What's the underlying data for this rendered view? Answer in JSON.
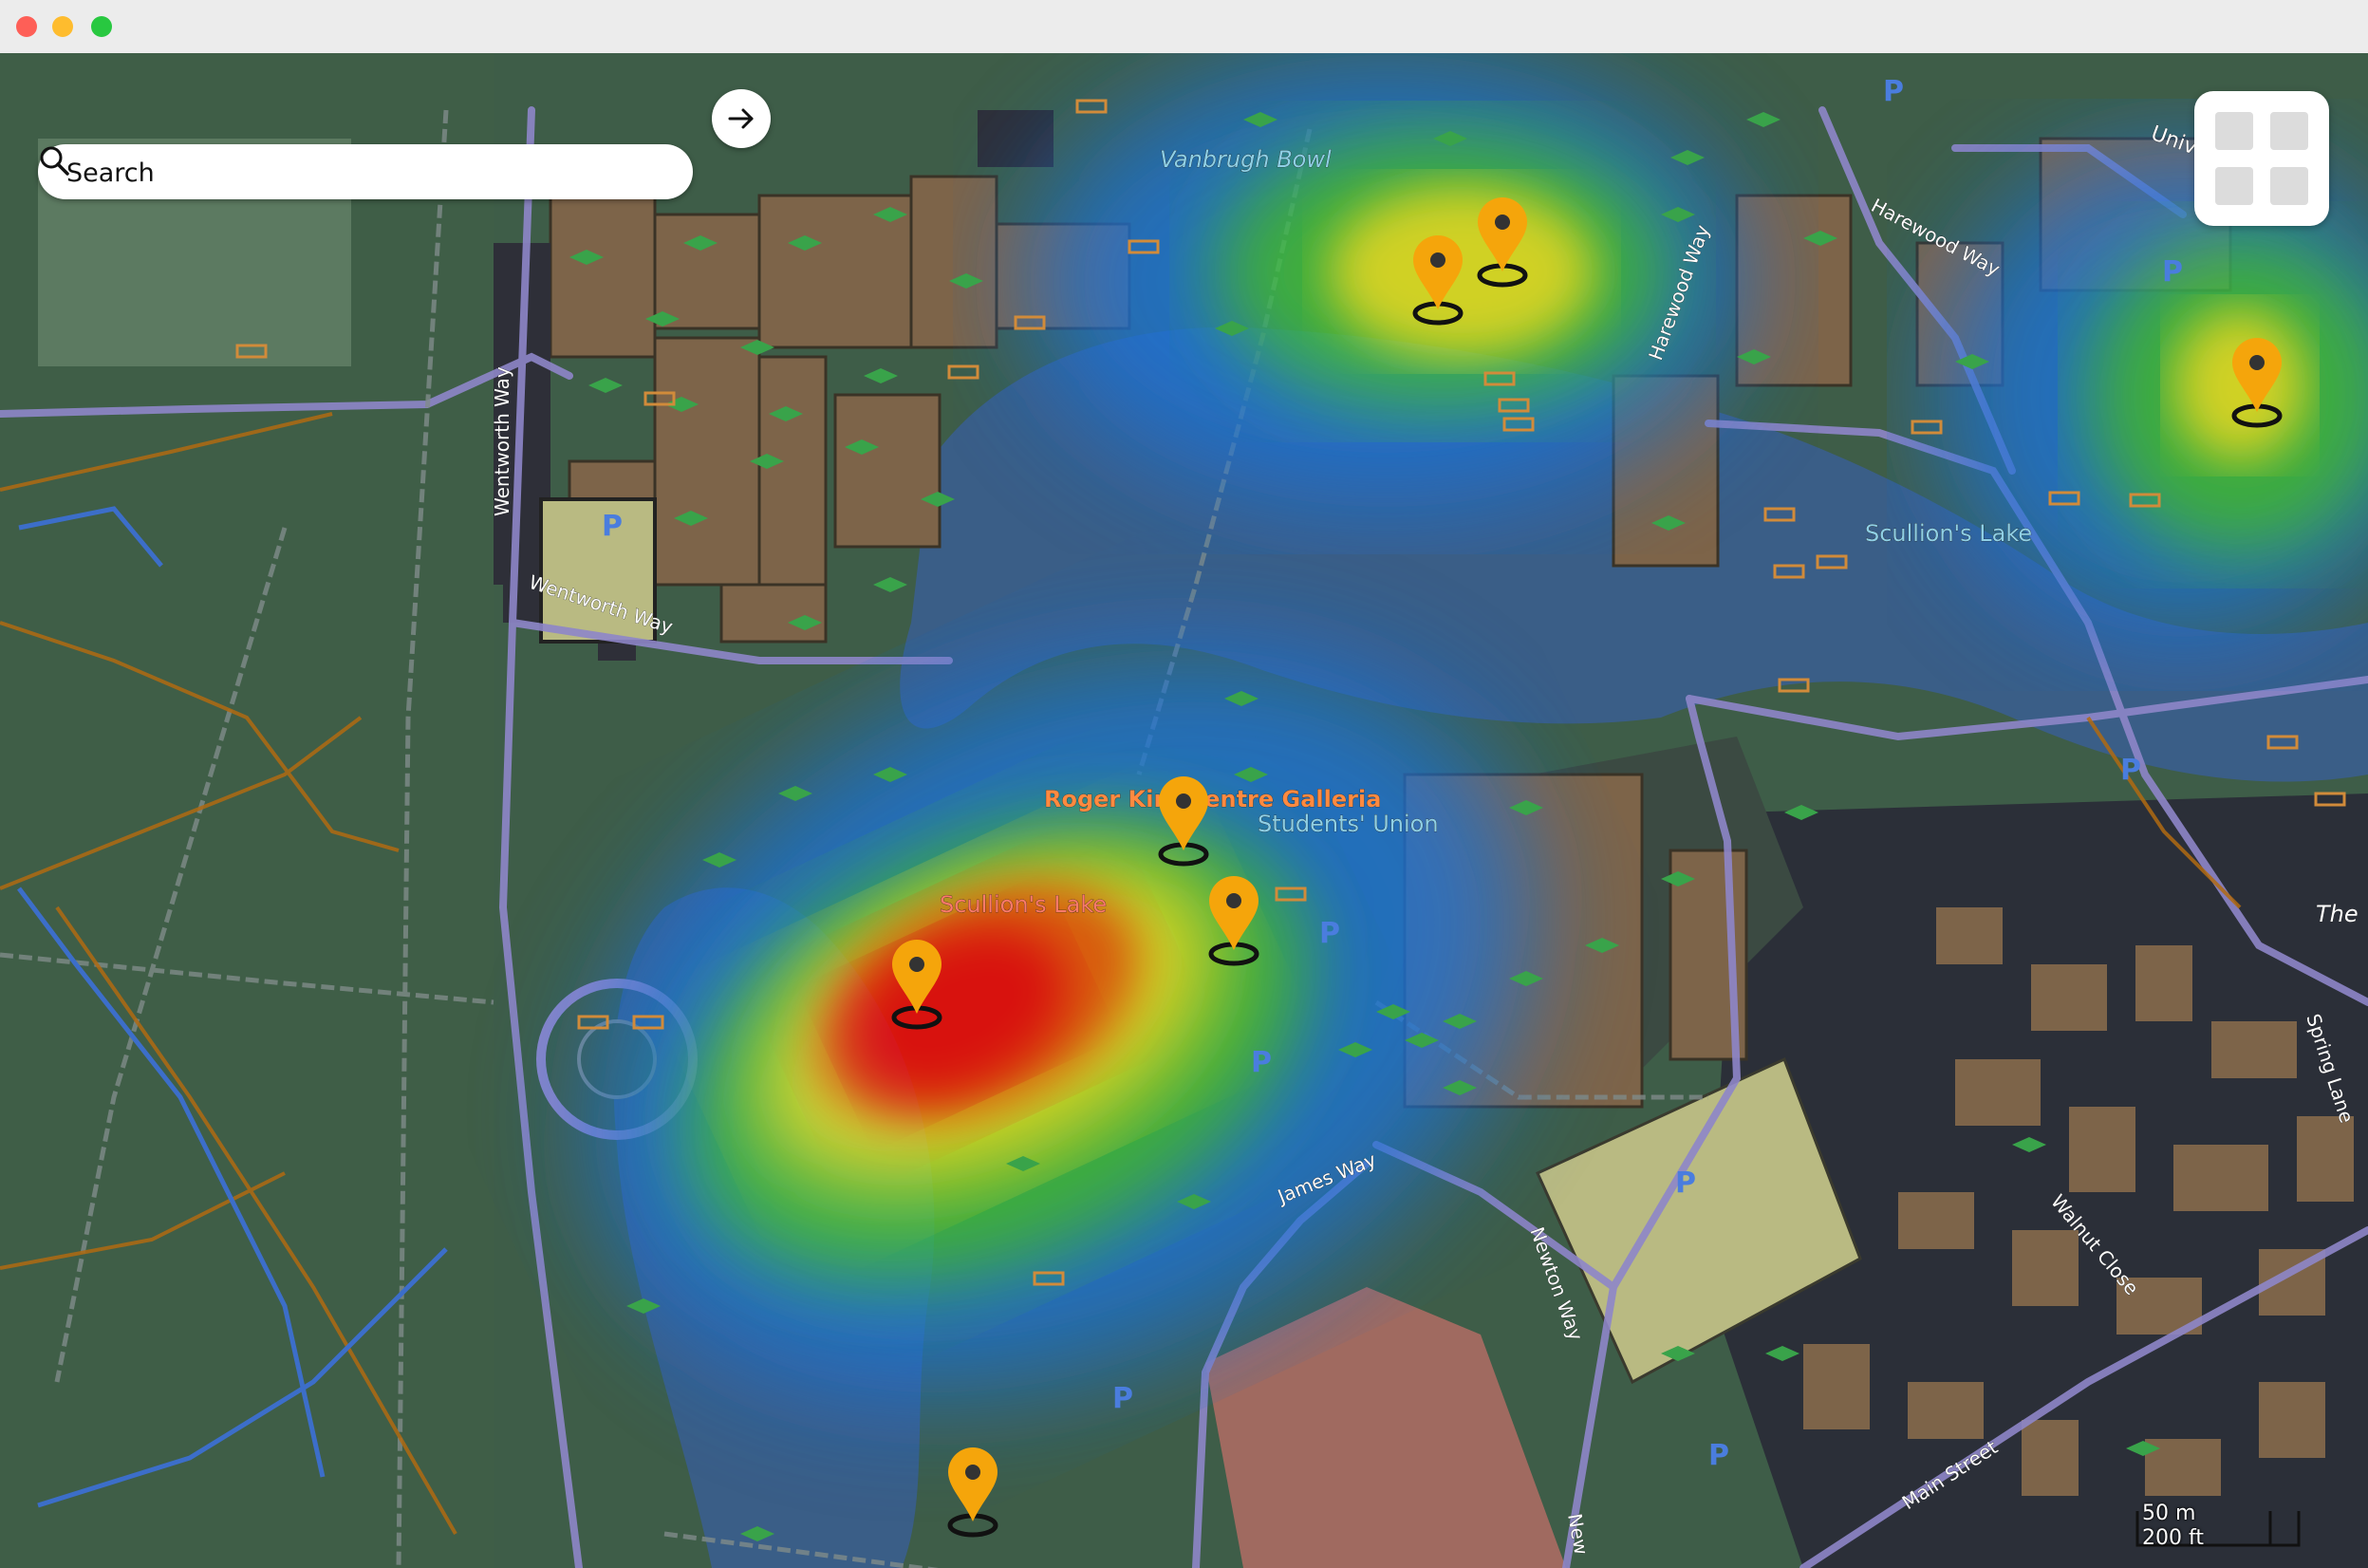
{
  "search": {
    "placeholder": "Search"
  },
  "map_labels": {
    "vanbrugh_bowl": "Vanbrugh Bowl",
    "harewood_way": "Harewood Way",
    "harewood_way_2": "Harewood Way",
    "wentworth_way_v": "Wentworth Way",
    "wentworth_way_h": "Wentworth Way",
    "university": "Univ",
    "sculmons_lake": "Scullion's Lake",
    "sculmons_lake_2": "Scullion's Lake",
    "roger_kirk": "Roger Kirk Centre Galleria",
    "students_union": "Students' Union",
    "james_way": "James Way",
    "newton_way": "Newton Way",
    "newton_way_2": "New",
    "walnut_close": "Walnut Close",
    "spring_lane": "Spring Lane",
    "main_street": "Main Street",
    "the": "The"
  },
  "scale": {
    "metric": "50 m",
    "imperial": "200 ft"
  },
  "icons": {
    "search": "search-icon",
    "go": "arrow-right-icon",
    "layers": "layers-grid-icon",
    "marker": "map-pin-icon"
  },
  "colors": {
    "heat_red": "#ff0000",
    "heat_yellow": "#ffff00",
    "heat_blue": "#1e73d8",
    "marker": "#f5a50b",
    "water": "#3a5e87",
    "park": "#3d5c47",
    "building": "#7d6449"
  },
  "markers": [
    {
      "name": "marker-vanbrugh-1"
    },
    {
      "name": "marker-vanbrugh-2"
    },
    {
      "name": "marker-east-campus"
    },
    {
      "name": "marker-roger-kirk"
    },
    {
      "name": "marker-students-union"
    },
    {
      "name": "marker-scullions-lake"
    },
    {
      "name": "marker-south"
    }
  ]
}
